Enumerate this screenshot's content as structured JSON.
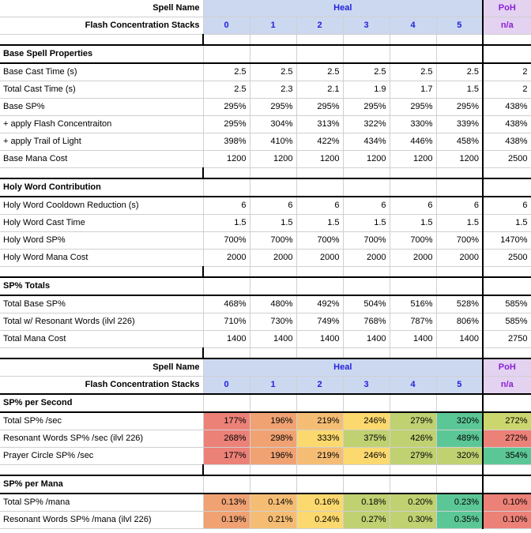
{
  "headers": {
    "spell_name_label": "Spell Name",
    "stacks_label": "Flash Concentration Stacks",
    "heal": "Heal",
    "poh": "PoH",
    "poh_stacks": "n/a",
    "stacks": [
      "0",
      "1",
      "2",
      "3",
      "4",
      "5"
    ]
  },
  "colors": {
    "heal_header_bg": "#ccd8f0",
    "heal_header_text": "#2222dd",
    "poh_header_bg": "#e3d2f0",
    "poh_header_text": "#8b1fd6",
    "heat_red": "#ec8178",
    "heat_orange": "#f0a273",
    "heat_amber": "#f5bd74",
    "heat_yellow": "#fcd96e",
    "heat_olive": "#bfd171",
    "heat_green": "#5cc796",
    "grid_line": "#d0d0d0",
    "heavy_line": "#000000"
  },
  "sections": {
    "base_spell_properties": {
      "title": "Base Spell Properties",
      "rows": [
        {
          "label": "Base Cast Time (s)",
          "values": [
            "2.5",
            "2.5",
            "2.5",
            "2.5",
            "2.5",
            "2.5"
          ],
          "poh": "2"
        },
        {
          "label": "Total Cast Time (s)",
          "values": [
            "2.5",
            "2.3",
            "2.1",
            "1.9",
            "1.7",
            "1.5"
          ],
          "poh": "2"
        },
        {
          "label": "Base SP%",
          "values": [
            "295%",
            "295%",
            "295%",
            "295%",
            "295%",
            "295%"
          ],
          "poh": "438%"
        },
        {
          "label": "+ apply Flash Concentraiton",
          "values": [
            "295%",
            "304%",
            "313%",
            "322%",
            "330%",
            "339%"
          ],
          "poh": "438%"
        },
        {
          "label": "+ apply Trail of Light",
          "values": [
            "398%",
            "410%",
            "422%",
            "434%",
            "446%",
            "458%"
          ],
          "poh": "438%"
        },
        {
          "label": "Base Mana Cost",
          "values": [
            "1200",
            "1200",
            "1200",
            "1200",
            "1200",
            "1200"
          ],
          "poh": "2500"
        }
      ]
    },
    "holy_word_contribution": {
      "title": "Holy Word Contribution",
      "rows": [
        {
          "label": "Holy Word Cooldown Reduction (s)",
          "values": [
            "6",
            "6",
            "6",
            "6",
            "6",
            "6"
          ],
          "poh": "6"
        },
        {
          "label": "Holy Word Cast Time",
          "values": [
            "1.5",
            "1.5",
            "1.5",
            "1.5",
            "1.5",
            "1.5"
          ],
          "poh": "1.5"
        },
        {
          "label": "Holy Word SP%",
          "values": [
            "700%",
            "700%",
            "700%",
            "700%",
            "700%",
            "700%"
          ],
          "poh": "1470%"
        },
        {
          "label": "Holy Word Mana Cost",
          "values": [
            "2000",
            "2000",
            "2000",
            "2000",
            "2000",
            "2000"
          ],
          "poh": "2500"
        }
      ]
    },
    "sp_totals": {
      "title": "SP% Totals",
      "rows": [
        {
          "label": "Total Base SP%",
          "values": [
            "468%",
            "480%",
            "492%",
            "504%",
            "516%",
            "528%"
          ],
          "poh": "585%"
        },
        {
          "label": "Total w/ Resonant Words (ilvl 226)",
          "values": [
            "710%",
            "730%",
            "749%",
            "768%",
            "787%",
            "806%"
          ],
          "poh": "585%"
        },
        {
          "label": "Total Mana Cost",
          "values": [
            "1400",
            "1400",
            "1400",
            "1400",
            "1400",
            "1400"
          ],
          "poh": "2750"
        }
      ]
    },
    "sp_per_second": {
      "title": "SP% per Second",
      "rows": [
        {
          "label": "Total SP% /sec",
          "values": [
            "177%",
            "196%",
            "219%",
            "246%",
            "279%",
            "320%"
          ],
          "poh": "272%"
        },
        {
          "label": "Resonant Words SP% /sec  (ilvl 226)",
          "values": [
            "268%",
            "298%",
            "333%",
            "375%",
            "426%",
            "489%"
          ],
          "poh": "272%"
        },
        {
          "label": "Prayer Circle SP% /sec",
          "values": [
            "177%",
            "196%",
            "219%",
            "246%",
            "279%",
            "320%"
          ],
          "poh": "354%"
        }
      ]
    },
    "sp_per_mana": {
      "title": "SP% per Mana",
      "rows": [
        {
          "label": "Total SP% /mana",
          "values": [
            "0.13%",
            "0.14%",
            "0.16%",
            "0.18%",
            "0.20%",
            "0.23%"
          ],
          "poh": "0.10%"
        },
        {
          "label": "Resonant Words SP% /mana (ilvl 226)",
          "values": [
            "0.19%",
            "0.21%",
            "0.24%",
            "0.27%",
            "0.30%",
            "0.35%"
          ],
          "poh": "0.10%"
        }
      ]
    }
  }
}
